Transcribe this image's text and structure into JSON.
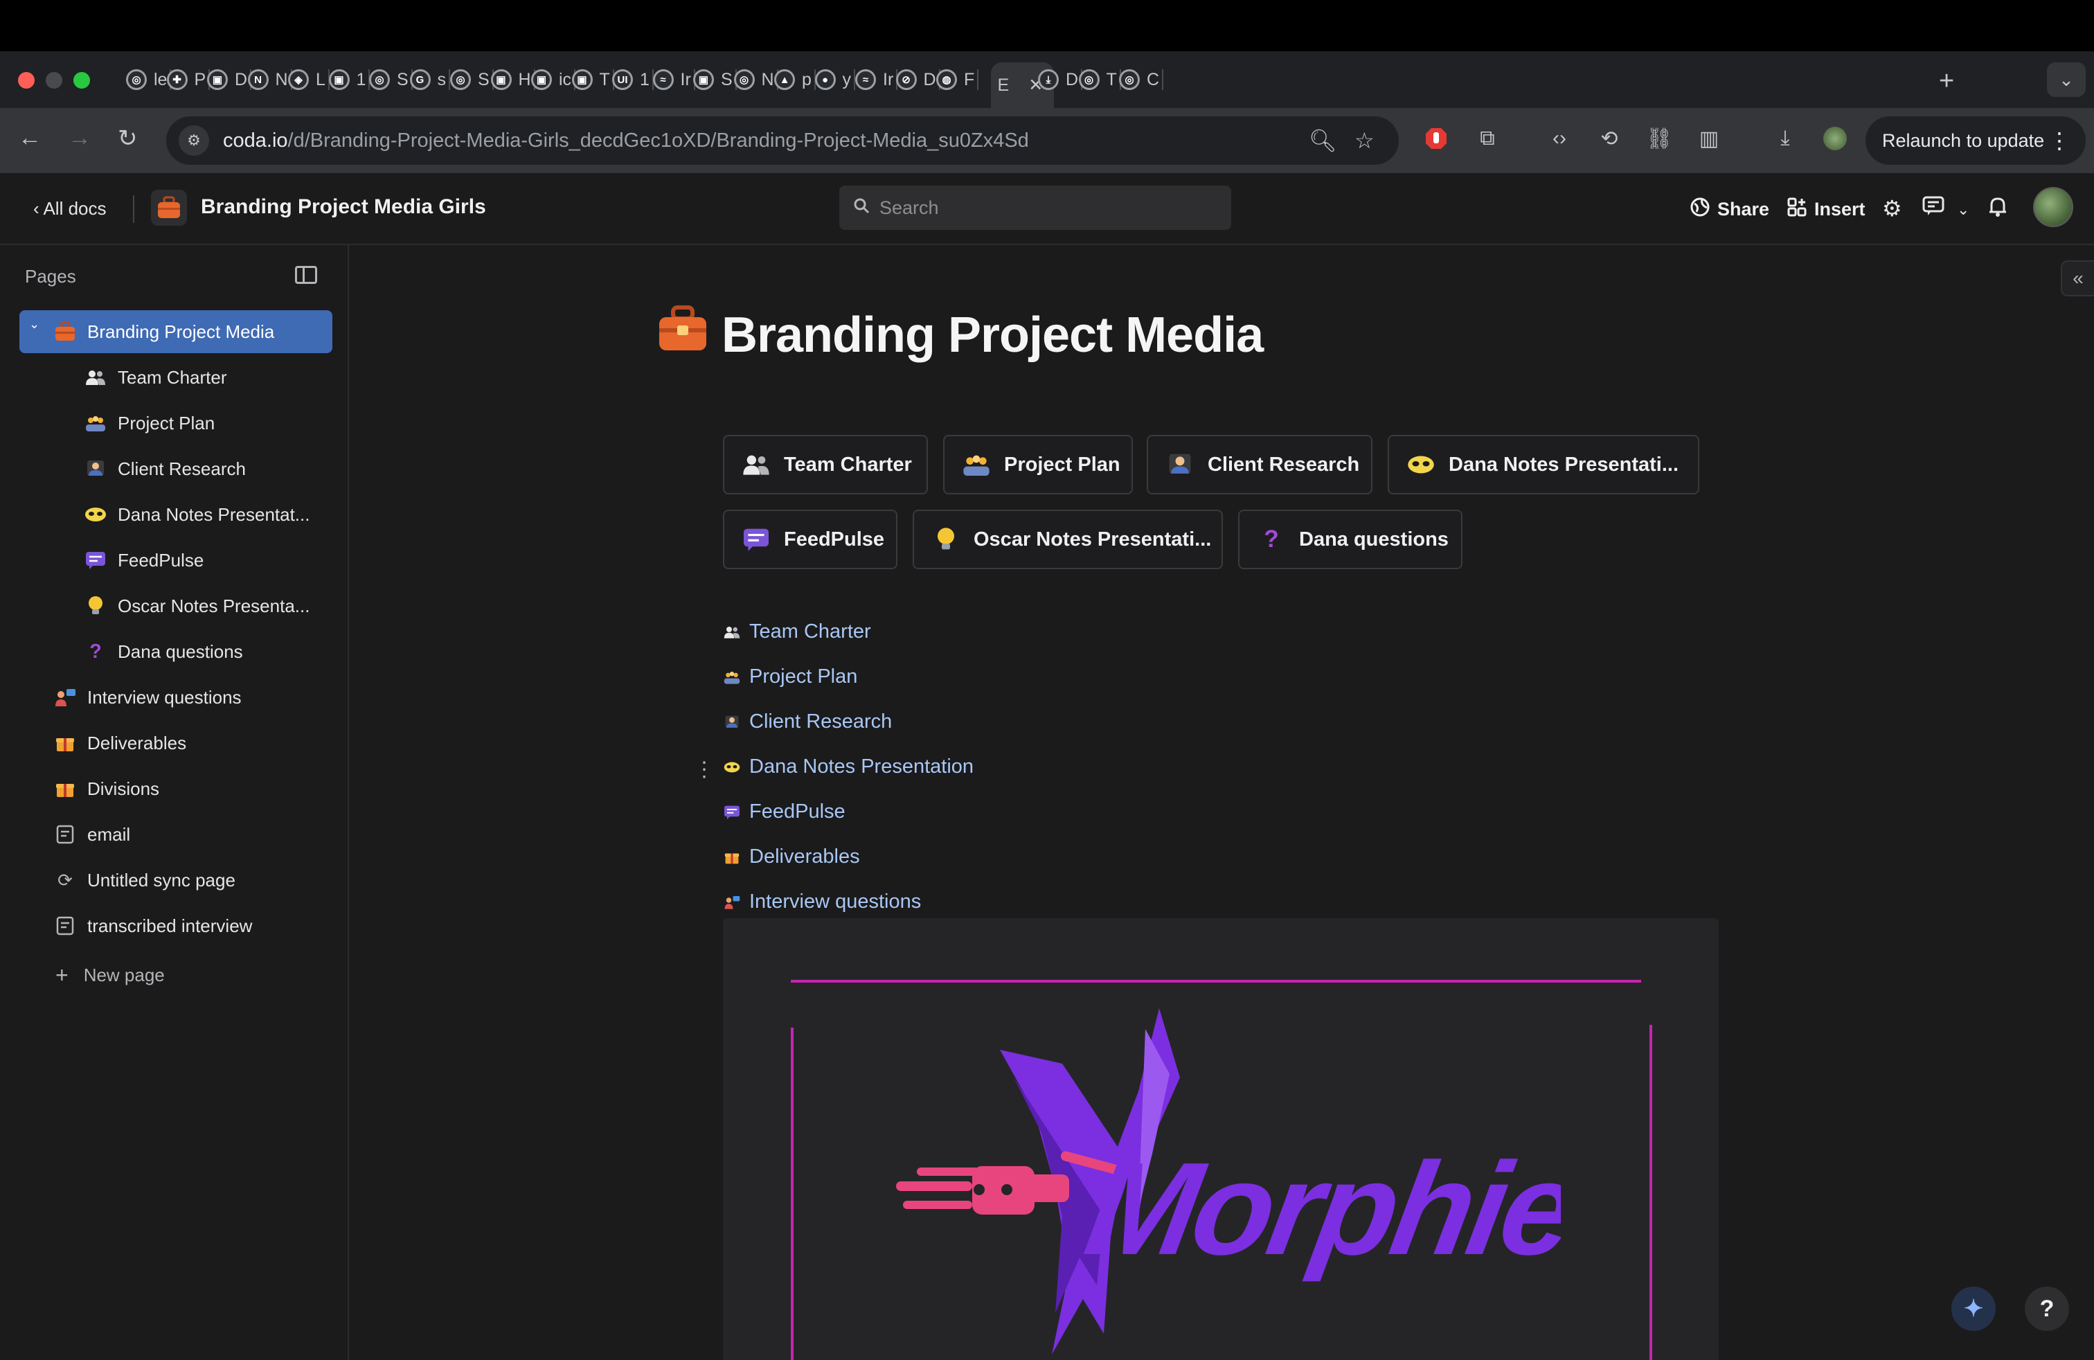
{
  "browser": {
    "tabs": [
      {
        "label": "le",
        "icon": "chromium-icon"
      },
      {
        "label": "P",
        "icon": "puzzle-icon"
      },
      {
        "label": "D",
        "icon": "app-icon"
      },
      {
        "label": "N",
        "icon": "notion-icon"
      },
      {
        "label": "L",
        "icon": "cube-icon"
      },
      {
        "label": "1",
        "icon": "app-icon"
      },
      {
        "label": "S",
        "icon": "chromium-icon"
      },
      {
        "label": "s",
        "icon": "google-icon"
      },
      {
        "label": "S",
        "icon": "chromium-icon"
      },
      {
        "label": "H",
        "icon": "app-icon"
      },
      {
        "label": "ic",
        "icon": "app-icon"
      },
      {
        "label": "T",
        "icon": "app-icon"
      },
      {
        "label": "1",
        "icon": "ui-icon"
      },
      {
        "label": "Ir",
        "icon": "wave-icon"
      },
      {
        "label": "S",
        "icon": "app-icon"
      },
      {
        "label": "N",
        "icon": "chromium-icon"
      },
      {
        "label": "p",
        "icon": "triangle-icon"
      },
      {
        "label": "y",
        "icon": "github-icon"
      },
      {
        "label": "Ir",
        "icon": "wave-icon"
      },
      {
        "label": "D",
        "icon": "slash-icon"
      },
      {
        "label": "F",
        "icon": "globe-icon"
      },
      {
        "label": "E",
        "icon": "doc-icon",
        "active": true
      },
      {
        "label": "D",
        "icon": "download-icon"
      },
      {
        "label": "T",
        "icon": "chromium-icon"
      },
      {
        "label": "C",
        "icon": "chromium-icon"
      }
    ],
    "url_host": "coda.io",
    "url_path": "/d/Branding-Project-Media-Girls_decdGec1oXD/Branding-Project-Media_su0Zx4Sd",
    "relaunch_label": "Relaunch to update"
  },
  "header": {
    "all_docs_label": "All docs",
    "doc_title": "Branding Project Media Girls",
    "search_placeholder": "Search",
    "share_label": "Share",
    "insert_label": "Insert"
  },
  "sidebar": {
    "pages_label": "Pages",
    "items": [
      {
        "label": "Branding Project Media",
        "icon": "briefcase-icon",
        "level": 0,
        "selected": true
      },
      {
        "label": "Team Charter",
        "icon": "people-icon",
        "level": 1
      },
      {
        "label": "Project Plan",
        "icon": "team-plan-icon",
        "level": 1
      },
      {
        "label": "Client Research",
        "icon": "researcher-icon",
        "level": 1
      },
      {
        "label": "Dana Notes Presentat...",
        "icon": "mask-icon",
        "level": 1
      },
      {
        "label": "FeedPulse",
        "icon": "chat-bubble-icon",
        "level": 1
      },
      {
        "label": "Oscar Notes Presenta...",
        "icon": "lightbulb-icon",
        "level": 1
      },
      {
        "label": "Dana questions",
        "icon": "question-icon",
        "level": 1
      },
      {
        "label": "Interview questions",
        "icon": "interview-icon",
        "level": 0
      },
      {
        "label": "Deliverables",
        "icon": "gift-icon",
        "level": 0
      },
      {
        "label": "Divisions",
        "icon": "gift-icon",
        "level": 0
      },
      {
        "label": "email",
        "icon": "page-icon",
        "level": 0
      },
      {
        "label": "Untitled sync page",
        "icon": "sync-icon",
        "level": 0
      },
      {
        "label": "transcribed interview",
        "icon": "page-icon",
        "level": 0
      }
    ],
    "new_page_label": "New page"
  },
  "main": {
    "page_title": "Branding Project Media",
    "cards": [
      {
        "label": "Team Charter",
        "icon": "people-icon"
      },
      {
        "label": "Project Plan",
        "icon": "team-plan-icon"
      },
      {
        "label": "Client Research",
        "icon": "researcher-icon"
      },
      {
        "label": "Dana Notes Presentati...",
        "icon": "mask-icon"
      },
      {
        "label": "FeedPulse",
        "icon": "chat-bubble-icon"
      },
      {
        "label": "Oscar Notes Presentati...",
        "icon": "lightbulb-icon"
      },
      {
        "label": "Dana questions",
        "icon": "question-icon"
      }
    ],
    "links": [
      {
        "label": "Team Charter",
        "icon": "people-icon"
      },
      {
        "label": "Project Plan",
        "icon": "team-plan-icon"
      },
      {
        "label": "Client Research",
        "icon": "researcher-icon"
      },
      {
        "label": "Dana Notes Presentation",
        "icon": "mask-icon"
      },
      {
        "label": "FeedPulse",
        "icon": "chat-bubble-icon"
      },
      {
        "label": "Deliverables",
        "icon": "gift-icon"
      },
      {
        "label": "Interview questions",
        "icon": "interview-icon"
      }
    ],
    "image": {
      "logo_text": "Morphienn"
    }
  },
  "colors": {
    "accent_selected": "#3f6ab4",
    "link": "#a9c7f5",
    "logo_purple": "#7b2fe0",
    "logo_magenta": "#c724b1",
    "logo_pink": "#e8457e"
  }
}
